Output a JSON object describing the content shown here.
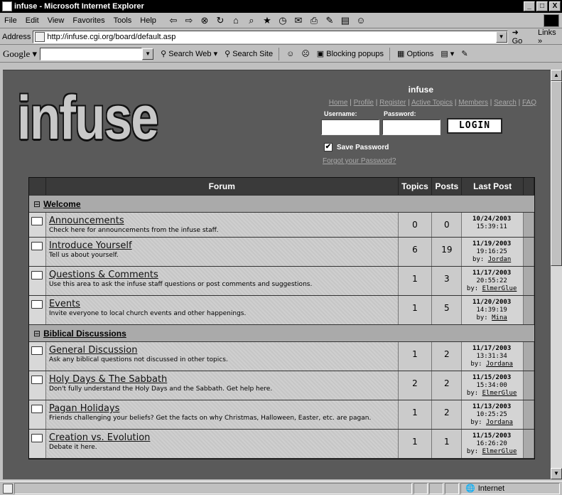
{
  "window": {
    "title": "infuse - Microsoft Internet Explorer",
    "minimize": "_",
    "maximize": "□",
    "close": "X"
  },
  "menu": [
    "File",
    "Edit",
    "View",
    "Favorites",
    "Tools",
    "Help"
  ],
  "address": {
    "label": "Address",
    "url": "http://infuse.cgi.org/board/default.asp",
    "go": "Go",
    "links": "Links »"
  },
  "google": {
    "logo": "Google",
    "search_web": "Search Web",
    "search_site": "Search Site",
    "blocking": "Blocking popups",
    "options": "Options"
  },
  "site": {
    "logo_text": "infuse",
    "name": "infuse",
    "nav": [
      "Home",
      "Profile",
      "Register",
      "Active Topics",
      "Members",
      "Search",
      "FAQ"
    ],
    "username_label": "Username:",
    "password_label": "Password:",
    "login_button": "LOGIN",
    "save_password": "Save Password",
    "forgot": "Forgot your Password?"
  },
  "table": {
    "headers": {
      "forum": "Forum",
      "topics": "Topics",
      "posts": "Posts",
      "last_post": "Last Post"
    },
    "categories": [
      {
        "name": "Welcome",
        "forums": [
          {
            "name": "Announcements",
            "desc": "Check here for announcements from the infuse staff.",
            "topics": "0",
            "posts": "0",
            "date": "10/24/2003",
            "time": "15:39:11",
            "by": ""
          },
          {
            "name": "Introduce Yourself",
            "desc": "Tell us about yourself.",
            "topics": "6",
            "posts": "19",
            "date": "11/19/2003",
            "time": "19:16:25",
            "by": "Jordan"
          },
          {
            "name": "Questions & Comments",
            "desc": "Use this area to ask the infuse staff questions or post comments and suggestions.",
            "topics": "1",
            "posts": "3",
            "date": "11/17/2003",
            "time": "20:55:22",
            "by": "ElmerGlue"
          },
          {
            "name": "Events",
            "desc": "Invite everyone to local church events and other happenings.",
            "topics": "1",
            "posts": "5",
            "date": "11/20/2003",
            "time": "14:39:19",
            "by": "Mina"
          }
        ]
      },
      {
        "name": "Biblical Discussions",
        "forums": [
          {
            "name": "General Discussion",
            "desc": "Ask any biblical questions not discussed in other topics.",
            "topics": "1",
            "posts": "2",
            "date": "11/17/2003",
            "time": "13:31:34",
            "by": "Jordana"
          },
          {
            "name": "Holy Days & The Sabbath",
            "desc": "Don't fully understand the Holy Days and the Sabbath. Get help here.",
            "topics": "2",
            "posts": "2",
            "date": "11/15/2003",
            "time": "15:34:00",
            "by": "ElmerGlue"
          },
          {
            "name": "Pagan Holidays",
            "desc": "Friends challenging your beliefs? Get the facts on why Christmas, Halloween, Easter, etc. are pagan.",
            "topics": "1",
            "posts": "2",
            "date": "11/13/2003",
            "time": "10:25:25",
            "by": "Jordana"
          },
          {
            "name": "Creation vs. Evolution",
            "desc": "Debate it here.",
            "topics": "1",
            "posts": "1",
            "date": "11/15/2003",
            "time": "16:26:20",
            "by": "ElmerGlue"
          }
        ]
      }
    ]
  },
  "status": {
    "zone": "Internet"
  }
}
